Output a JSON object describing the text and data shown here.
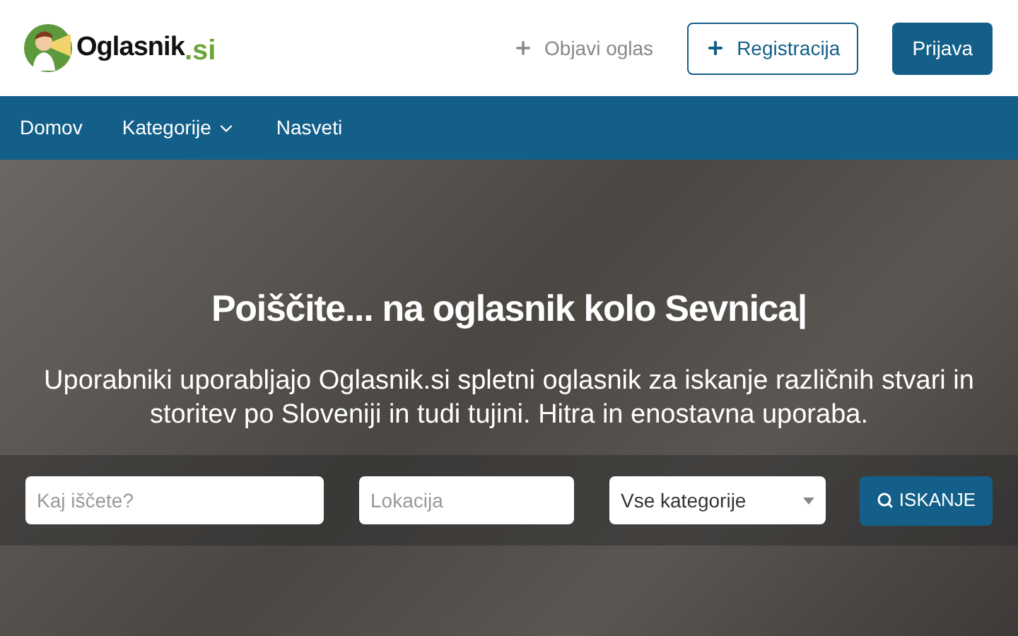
{
  "logo": {
    "name": "Oglasnik",
    "suffix": ".si"
  },
  "header_actions": [
    {
      "kind": "link",
      "label": "Objavi oglas"
    },
    {
      "kind": "outline",
      "label": "Registracija"
    },
    {
      "kind": "solid",
      "label": "Prijava"
    }
  ],
  "nav": [
    {
      "label": "Domov",
      "dropdown": false
    },
    {
      "label": "Kategorije",
      "dropdown": true
    },
    {
      "label": "Nasveti",
      "dropdown": false
    }
  ],
  "hero": {
    "title": "Poiščite... na oglasnik kolo Sevnica|",
    "subtitle": "Uporabniki uporabljajo Oglasnik.si spletni oglasnik za iskanje različnih stvari in storitev po Sloveniji in tudi tujini. Hitra in enostavna uporaba."
  },
  "search": {
    "query_placeholder": "Kaj iščete?",
    "location_placeholder": "Lokacija",
    "category": "Vse kategorije",
    "button": "ISKANJE"
  }
}
